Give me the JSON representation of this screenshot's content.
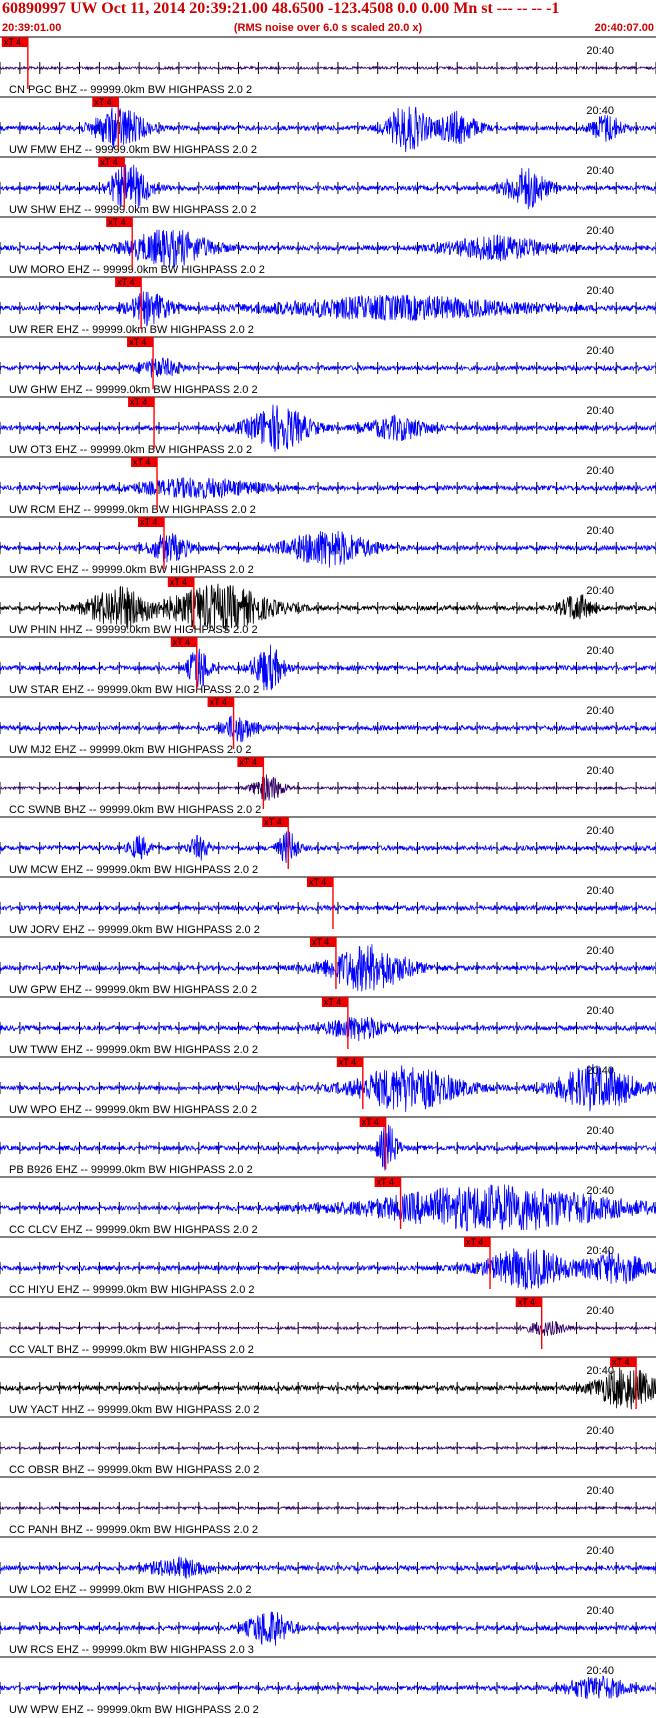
{
  "header": {
    "title": "60890997 UW Oct 11, 2014 20:39:21.00   48.6500 -123.4508  0.0 0.00 Mn st --- -- --  -1",
    "subtitle": "(RMS noise over 6.0 s scaled 20.0 x)",
    "time_start": "20:39:01.00",
    "time_end": "20:40:07.00"
  },
  "colors": {
    "header": "#cc0000",
    "blue": "#0000ff",
    "purple": "#330066",
    "black": "#000000",
    "pick": "#ee0000",
    "pick_line": "#ff0000"
  },
  "chart_data": {
    "type": "line",
    "title": "60890997 UW Oct 11, 2014 20:39:21.00   48.6500 -123.4508  0.0 0.00 Mn st --- -- --  -1",
    "x_unit": "seconds after 20:39:01.00",
    "xlim": [
      0,
      66
    ],
    "tick_every_s": 2,
    "minute_label": "20:40",
    "minute_label_time_s": 59,
    "pick_label": "xT 4",
    "traces": [
      {
        "station": "CN PGC BHZ -- 99999.0km BW  HIGHPASS  2.0  2",
        "color": "purple",
        "pick_s": 2.8,
        "activity": []
      },
      {
        "station": "UW FMW EHZ -- 99999.0km BW  HIGHPASS  2.0  2",
        "color": "blue",
        "pick_s": 11.9,
        "activity": [
          [
            12,
            2.5,
            0.9
          ],
          [
            41,
            2,
            1.0
          ],
          [
            46,
            2,
            0.7
          ],
          [
            61,
            1.5,
            0.6
          ]
        ]
      },
      {
        "station": "UW SHW EHZ -- 99999.0km BW  HIGHPASS  2.0  2",
        "color": "blue",
        "pick_s": 12.5,
        "activity": [
          [
            13,
            2,
            1.0
          ],
          [
            53,
            2,
            0.9
          ]
        ]
      },
      {
        "station": "UW MORO EHZ -- 99999.0km BW  HIGHPASS  2.0  2",
        "color": "blue",
        "pick_s": 13.3,
        "activity": [
          [
            17,
            4,
            0.8
          ],
          [
            50,
            5,
            0.5
          ]
        ]
      },
      {
        "station": "UW RER EHZ -- 99999.0km BW  HIGHPASS  2.0  2",
        "color": "blue",
        "pick_s": 14.2,
        "activity": [
          [
            15,
            2,
            0.7
          ],
          [
            40,
            12,
            0.5
          ]
        ]
      },
      {
        "station": "UW GHW EHZ -- 99999.0km BW  HIGHPASS  2.0  2",
        "color": "blue",
        "pick_s": 15.4,
        "activity": [
          [
            16,
            2,
            0.4
          ]
        ]
      },
      {
        "station": "UW OT3 EHZ -- 99999.0km BW  HIGHPASS  2.0  2",
        "color": "blue",
        "pick_s": 15.5,
        "activity": [
          [
            28,
            3,
            1.0
          ],
          [
            40,
            3,
            0.5
          ]
        ]
      },
      {
        "station": "UW RCM EHZ -- 99999.0km BW  HIGHPASS  2.0  2",
        "color": "blue",
        "pick_s": 15.8,
        "activity": [
          [
            20,
            6,
            0.4
          ]
        ]
      },
      {
        "station": "UW RVC EHZ -- 99999.0km BW  HIGHPASS  2.0  2",
        "color": "blue",
        "pick_s": 16.5,
        "activity": [
          [
            17,
            2,
            0.6
          ],
          [
            33,
            4,
            0.8
          ]
        ]
      },
      {
        "station": "UW PHIN HHZ -- 99999.0km BW  HIGHPASS  2.0  2",
        "color": "black",
        "pick_s": 19.5,
        "activity": [
          [
            12,
            3,
            0.9
          ],
          [
            22,
            5,
            1.0
          ],
          [
            58,
            1.5,
            0.6
          ]
        ]
      },
      {
        "station": "UW STAR EHZ -- 99999.0km BW  HIGHPASS  2.0  2",
        "color": "blue",
        "pick_s": 19.8,
        "activity": [
          [
            20,
            1,
            1.0
          ],
          [
            27,
            1.5,
            1.0
          ]
        ]
      },
      {
        "station": "UW MJ2 EHZ -- 99999.0km BW  HIGHPASS  2.0  2",
        "color": "blue",
        "pick_s": 23.5,
        "activity": [
          [
            24,
            1.5,
            0.6
          ]
        ]
      },
      {
        "station": "CC SWNB BHZ -- 99999.0km BW  HIGHPASS  2.0  2",
        "color": "purple",
        "pick_s": 26.5,
        "activity": [
          [
            27,
            1.5,
            0.6
          ]
        ]
      },
      {
        "station": "UW MCW EHZ -- 99999.0km BW  HIGHPASS  2.0  2",
        "color": "blue",
        "pick_s": 29.0,
        "activity": [
          [
            14,
            1,
            0.5
          ],
          [
            20,
            1,
            0.5
          ],
          [
            29,
            1,
            0.7
          ]
        ]
      },
      {
        "station": "UW JORV EHZ -- 99999.0km BW  HIGHPASS  2.0  2",
        "color": "blue",
        "pick_s": 33.5,
        "activity": []
      },
      {
        "station": "UW GPW EHZ -- 99999.0km BW  HIGHPASS  2.0  2",
        "color": "blue",
        "pick_s": 33.8,
        "activity": [
          [
            37,
            4,
            1.0
          ]
        ]
      },
      {
        "station": "UW TWW EHZ -- 99999.0km BW  HIGHPASS  2.0  2",
        "color": "blue",
        "pick_s": 35.0,
        "activity": [
          [
            36,
            3,
            0.5
          ]
        ]
      },
      {
        "station": "UW WPO EHZ -- 99999.0km BW  HIGHPASS  2.0  2",
        "color": "blue",
        "pick_s": 36.5,
        "activity": [
          [
            41,
            5,
            1.0
          ],
          [
            60,
            4,
            1.0
          ]
        ]
      },
      {
        "station": "PB B926 EHZ -- 99999.0km BW  HIGHPASS  2.0  2",
        "color": "blue",
        "pick_s": 38.8,
        "activity": [
          [
            39,
            1,
            1.0
          ]
        ]
      },
      {
        "station": "CC CLCV EHZ -- 99999.0km BW  HIGHPASS  2.0  2",
        "color": "blue",
        "pick_s": 40.3,
        "activity": [
          [
            50,
            12,
            1.0
          ]
        ]
      },
      {
        "station": "CC HIYU EHZ -- 99999.0km BW  HIGHPASS  2.0  2",
        "color": "blue",
        "pick_s": 49.3,
        "activity": [
          [
            53,
            4,
            0.9
          ],
          [
            62,
            3,
            0.7
          ]
        ]
      },
      {
        "station": "CC VALT BHZ -- 99999.0km BW  HIGHPASS  2.0  2",
        "color": "purple",
        "pick_s": 54.5,
        "activity": [
          [
            55,
            2,
            0.3
          ]
        ]
      },
      {
        "station": "UW YACT HHZ -- 99999.0km BW  HIGHPASS  2.0  2",
        "color": "black",
        "pick_s": 64.0,
        "activity": [
          [
            63,
            3,
            0.9
          ]
        ]
      },
      {
        "station": "CC OBSR BHZ -- 99999.0km BW  HIGHPASS  2.0  2",
        "color": "purple",
        "pick_s": null,
        "activity": []
      },
      {
        "station": "CC PANH BHZ -- 99999.0km BW  HIGHPASS  2.0  2",
        "color": "purple",
        "pick_s": null,
        "activity": []
      },
      {
        "station": "UW LO2 EHZ -- 99999.0km BW  HIGHPASS  2.0  2",
        "color": "blue",
        "pick_s": null,
        "activity": [
          [
            18,
            3,
            0.4
          ]
        ]
      },
      {
        "station": "UW RCS EHZ -- 99999.0km BW  HIGHPASS  2.0  3",
        "color": "blue",
        "pick_s": null,
        "activity": [
          [
            27,
            2,
            0.8
          ]
        ]
      },
      {
        "station": "UW WPW EHZ -- 99999.0km BW  HIGHPASS  2.0  2",
        "color": "blue",
        "pick_s": null,
        "activity": [
          [
            60,
            3,
            0.5
          ]
        ]
      }
    ]
  }
}
